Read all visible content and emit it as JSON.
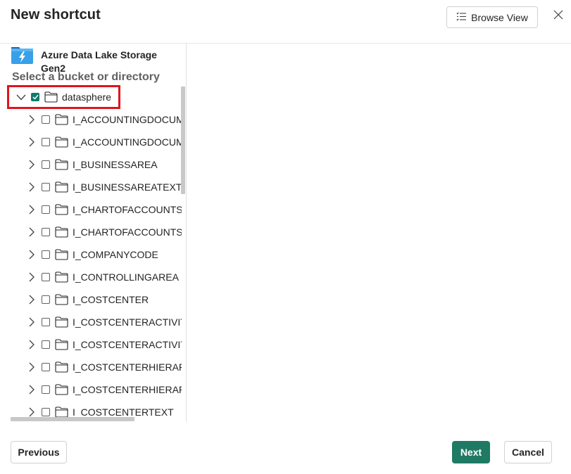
{
  "dialog": {
    "title": "New shortcut",
    "browse_view_label": "Browse View"
  },
  "source": {
    "name": "Azure Data Lake Storage Gen2",
    "icon": "azure-data-lake-icon"
  },
  "tree": {
    "subtitle": "Select a bucket or directory",
    "root": {
      "label": "datasphere",
      "expanded": true,
      "checked": true
    },
    "children": [
      {
        "label": "I_ACCOUNTINGDOCUME",
        "checked": false
      },
      {
        "label": "I_ACCOUNTINGDOCUME",
        "checked": false
      },
      {
        "label": "I_BUSINESSAREA",
        "checked": false
      },
      {
        "label": "I_BUSINESSAREATEXT",
        "checked": false
      },
      {
        "label": "I_CHARTOFACCOUNTS",
        "checked": false
      },
      {
        "label": "I_CHARTOFACCOUNTSTE",
        "checked": false
      },
      {
        "label": "I_COMPANYCODE",
        "checked": false
      },
      {
        "label": "I_CONTROLLINGAREA",
        "checked": false
      },
      {
        "label": "I_COSTCENTER",
        "checked": false
      },
      {
        "label": "I_COSTCENTERACTIVITYT",
        "checked": false
      },
      {
        "label": "I_COSTCENTERACTIVITYT",
        "checked": false
      },
      {
        "label": "I_COSTCENTERHIERARCH",
        "checked": false
      },
      {
        "label": "I_COSTCENTERHIERARCH",
        "checked": false
      },
      {
        "label": "I_COSTCENTERTEXT",
        "checked": false
      }
    ]
  },
  "footer": {
    "previous_label": "Previous",
    "next_label": "Next",
    "cancel_label": "Cancel"
  },
  "colors": {
    "accent": "#1f7a64",
    "checkbox_checked": "#11796d",
    "highlight": "#e0141e"
  }
}
